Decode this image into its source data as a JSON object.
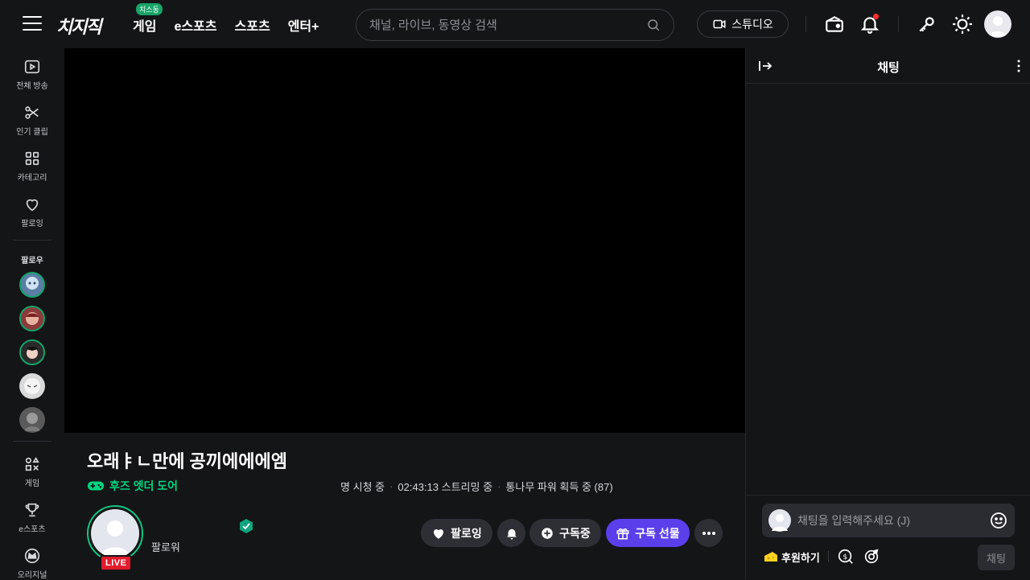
{
  "header": {
    "logo": "치지직",
    "nav": [
      {
        "label": "게임",
        "badge": "치스동"
      },
      {
        "label": "e스포츠"
      },
      {
        "label": "스포츠"
      },
      {
        "label": "엔터+"
      }
    ],
    "search_placeholder": "채널, 라이브, 동영상 검색",
    "studio_label": "스튜디오"
  },
  "sidebar": {
    "items_top": [
      {
        "label": "전체 방송",
        "icon": "play-icon"
      },
      {
        "label": "인기 클립",
        "icon": "scissors-icon"
      },
      {
        "label": "카테고리",
        "icon": "grid-icon"
      },
      {
        "label": "팔로잉",
        "icon": "heart-icon"
      }
    ],
    "following_heading": "팔로우",
    "following_count": 5,
    "items_bottom": [
      {
        "label": "게임",
        "icon": "shapes-icon"
      },
      {
        "label": "e스포츠",
        "icon": "trophy-icon"
      },
      {
        "label": "오리지널",
        "icon": "crown-icon"
      }
    ]
  },
  "stream": {
    "title": "오래ㅑㄴ만에 공끼에에에엠",
    "category": "후즈 엣더 도어",
    "viewers": "명 시청 중",
    "duration": "02:43:13 스트리밍 중",
    "power": "통나무 파워 획득 중 (87)",
    "live_badge": "LIVE",
    "followers_label": "팔로워",
    "buttons": {
      "following": "팔로잉",
      "subscribed": "구독중",
      "gift": "구독 선물"
    }
  },
  "chat": {
    "title": "채팅",
    "input_placeholder": "채팅을 입력해주세요 (J)",
    "donate_label": "후원하기",
    "send_label": "채팅"
  },
  "colors": {
    "accent_green": "#00d47f",
    "live_red": "#e31c2d",
    "gift_purple": "#5a3fea",
    "background": "#141517"
  }
}
